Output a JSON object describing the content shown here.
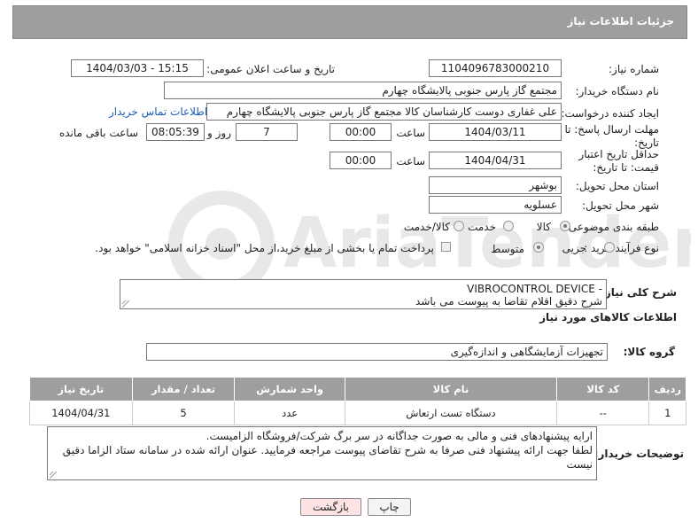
{
  "header": {
    "title": "جزئیات اطلاعات نیاز"
  },
  "form": {
    "need_number": {
      "label": "شماره نیاز:",
      "value": "1104096783000210"
    },
    "announce": {
      "label": "تاریخ و ساعت اعلان عمومی:",
      "value": "1404/03/03 - 15:15"
    },
    "buyer_org": {
      "label": "نام دستگاه خریدار:",
      "value": "مجتمع گاز پارس جنوبی  پالایشگاه چهارم"
    },
    "requester": {
      "label": "ایجاد کننده درخواست:",
      "value": "علی غفاری دوست کارشناسان کالا مجتمع گاز پارس جنوبی  پالایشگاه چهارم",
      "contact_link": "اطلاعات تماس خریدار"
    },
    "deadline": {
      "label": "مهلت ارسال پاسخ: تا تاریخ:",
      "date": "1404/03/11",
      "time_label": "ساعت",
      "time": "00:00",
      "days": "7",
      "days_label": "روز و",
      "remaining": "08:05:39",
      "remaining_label": "ساعت باقی مانده"
    },
    "price_validity": {
      "label": "حداقل تاریخ اعتبار قیمت: تا تاریخ:",
      "date": "1404/04/31",
      "time_label": "ساعت",
      "time": "00:00"
    },
    "province": {
      "label": "استان محل تحویل:",
      "value": "بوشهر"
    },
    "city": {
      "label": "شهر محل تحویل:",
      "value": "عسلویه"
    },
    "category": {
      "label": "طبقه بندی موضوعی:",
      "options": [
        "کالا",
        "خدمت",
        "کالا/خدمت"
      ],
      "selected": "کالا"
    },
    "process": {
      "label": "نوع فرآیند خرید :",
      "options": [
        "جزیی",
        "متوسط"
      ],
      "selected": "متوسط",
      "note": "پرداخت تمام یا بخشی از مبلغ خرید،از محل \"اسناد خزانه اسلامی\" خواهد بود."
    }
  },
  "description": {
    "label": "شرح کلی نیاز:",
    "line1": "VIBROCONTROL DEVICE -",
    "line2": "شرح دقیق اقلام تقاضا به پیوست می باشد"
  },
  "goods_info": {
    "title": "اطلاعات کالاهای مورد نیاز"
  },
  "goods_group": {
    "label": "گروه کالا:",
    "value": "تجهیزات آزمایشگاهی و اندازه‌گیری"
  },
  "table": {
    "headers": [
      "ردیف",
      "کد کالا",
      "نام کالا",
      "واحد شمارش",
      "تعداد / مقدار",
      "تاریخ نیاز"
    ],
    "rows": [
      {
        "row": "1",
        "code": "--",
        "name": "دستگاه تست ارتعاش",
        "unit": "عدد",
        "qty": "5",
        "date": "1404/04/31"
      }
    ]
  },
  "buyer_notes": {
    "label": "توضیحات خریدار:",
    "line1": "ارایه پیشنهادهای فنی و مالی به صورت جداگانه در سر برگ شرکت/فروشگاه الزامیست.",
    "line2": "لطفا جهت ارائه پیشنهاد فنی صرفا به شرح تقاضای پیوست مراجعه فرمایید. عنوان ارائه شده در سامانه ستاد الزاما دقیق",
    "line3": "نیست"
  },
  "buttons": {
    "print": "چاپ",
    "back": "بازگشت"
  },
  "colors": {
    "header_bg": "#9e9e9e",
    "link": "#1a5fb4",
    "back_btn_bg": "#fde3e3"
  }
}
